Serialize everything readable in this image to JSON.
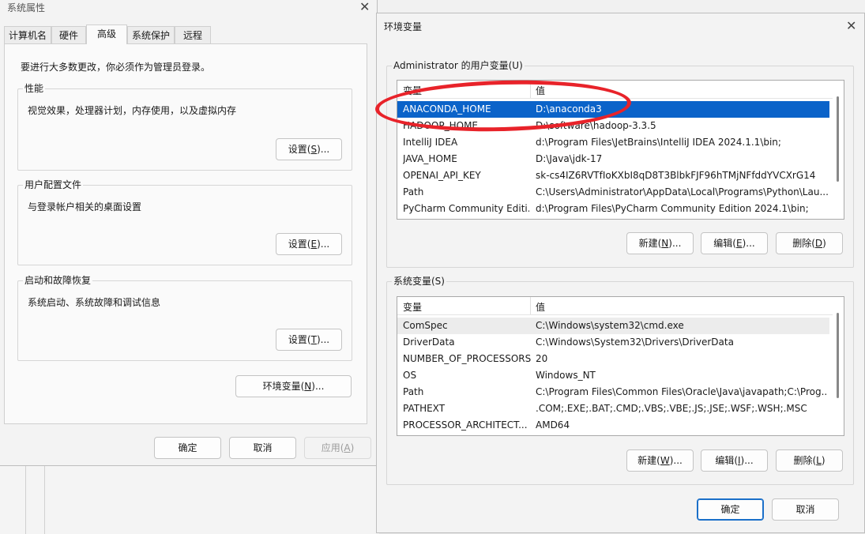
{
  "sysprop": {
    "title": "系统属性",
    "tabs": [
      "计算机名",
      "硬件",
      "高级",
      "系统保护",
      "远程"
    ],
    "notice": "要进行大多数更改，你必须作为管理员登录。",
    "performance": {
      "label": "性能",
      "desc": "视觉效果，处理器计划，内存使用，以及虚拟内存",
      "button_text": "设置(",
      "button_key": "S",
      "button_end": ")..."
    },
    "profile": {
      "label": "用户配置文件",
      "desc": "与登录帐户相关的桌面设置",
      "button_text": "设置(",
      "button_key": "E",
      "button_end": ")..."
    },
    "startup": {
      "label": "启动和故障恢复",
      "desc": "系统启动、系统故障和调试信息",
      "button_text": "设置(",
      "button_key": "T",
      "button_end": ")..."
    },
    "env_button": {
      "text": "环境变量(",
      "key": "N",
      "end": ")..."
    },
    "ok": "确定",
    "cancel": "取消",
    "apply": {
      "text": "应用(",
      "key": "A",
      "end": ")"
    }
  },
  "envvars": {
    "title": "环境变量",
    "user_section": "Administrator 的用户变量(U)",
    "user_headers": {
      "name": "变量",
      "value": "值"
    },
    "user_rows": [
      {
        "name": "ANACONDA_HOME",
        "value": "D:\\anaconda3"
      },
      {
        "name": "HADOOP_HOME",
        "value": "D:\\software\\hadoop-3.3.5"
      },
      {
        "name": "IntelliJ IDEA",
        "value": "d:\\Program Files\\JetBrains\\IntelliJ IDEA 2024.1.1\\bin;"
      },
      {
        "name": "JAVA_HOME",
        "value": "D:\\Java\\jdk-17"
      },
      {
        "name": "OPENAI_API_KEY",
        "value": "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"
      },
      {
        "name": "Path",
        "value": "C:\\Users\\Administrator\\AppData\\Local\\Programs\\Python\\Lau..."
      },
      {
        "name": "PyCharm Community Editi...",
        "value": "d:\\Program Files\\PyCharm Community Edition 2024.1\\bin;"
      }
    ],
    "user_buttons": {
      "new": {
        "text": "新建(",
        "key": "N",
        "end": ")..."
      },
      "edit": {
        "text": "编辑(",
        "key": "E",
        "end": ")..."
      },
      "delete": {
        "text": "删除(",
        "key": "D",
        "end": ")"
      }
    },
    "sys_section": "系统变量(S)",
    "sys_headers": {
      "name": "变量",
      "value": "值"
    },
    "sys_rows": [
      {
        "name": "ComSpec",
        "value": "C:\\Windows\\system32\\cmd.exe"
      },
      {
        "name": "DriverData",
        "value": "C:\\Windows\\System32\\Drivers\\DriverData"
      },
      {
        "name": "NUMBER_OF_PROCESSORS",
        "value": "20"
      },
      {
        "name": "OS",
        "value": "Windows_NT"
      },
      {
        "name": "Path",
        "value": "C:\\Program Files\\Common Files\\Oracle\\Java\\javapath;C:\\Prog..."
      },
      {
        "name": "PATHEXT",
        "value": ".COM;.EXE;.BAT;.CMD;.VBS;.VBE;.JS;.JSE;.WSF;.WSH;.MSC"
      },
      {
        "name": "PROCESSOR_ARCHITECT...",
        "value": "AMD64"
      }
    ],
    "sys_buttons": {
      "new": {
        "text": "新建(",
        "key": "W",
        "end": ")..."
      },
      "edit": {
        "text": "编辑(",
        "key": "I",
        "end": ")..."
      },
      "delete": {
        "text": "删除(",
        "key": "L",
        "end": ")"
      }
    },
    "ok": "确定",
    "cancel": "取消"
  },
  "colors": {
    "selection": "#0b63c9",
    "annotation": "#e8232a",
    "primary_border": "#1a6fc9"
  }
}
